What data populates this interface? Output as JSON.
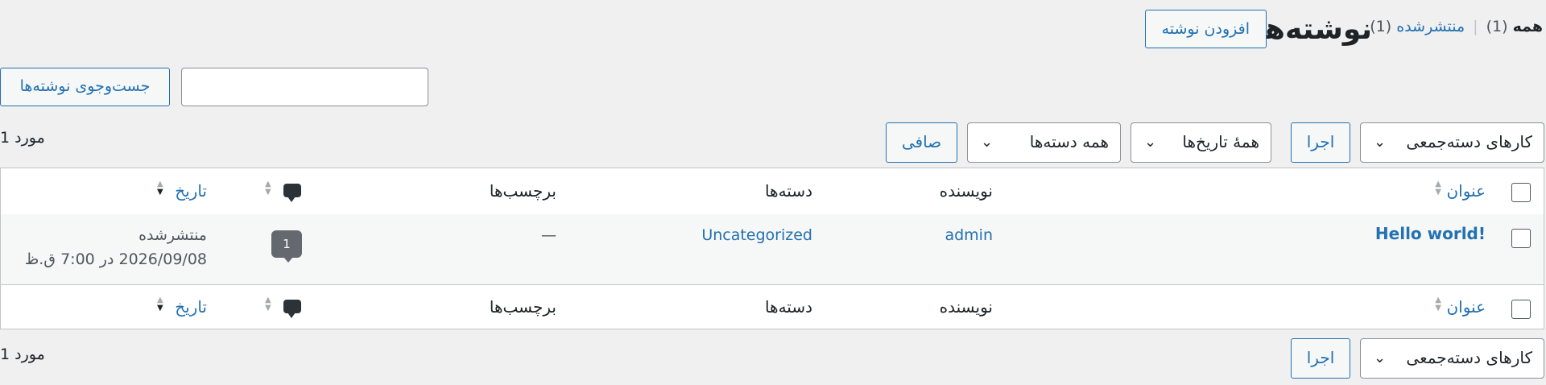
{
  "header": {
    "title": "نوشته‌ها",
    "add_new": "افزودن نوشته"
  },
  "views": {
    "all_label": "همه",
    "all_count": "(1)",
    "separator": "|",
    "published_label": "منتشرشده",
    "published_count": "(1)"
  },
  "search": {
    "input_value": "",
    "button_label": "جست‌وجوی نوشته‌ها"
  },
  "tablenav_top": {
    "bulk_actions": "کارهای دسته‌جمعی",
    "apply": "اجرا",
    "dates": "همهٔ تاریخ‌ها",
    "categories": "همه دسته‌ها",
    "filter": "صافی",
    "items_count": "1 مورد"
  },
  "columns": {
    "title": "عنوان",
    "author": "نویسنده",
    "categories": "دسته‌ها",
    "tags": "برچسب‌ها",
    "date": "تاریخ"
  },
  "rows": [
    {
      "title": "Hello world!",
      "author": "admin",
      "categories": "Uncategorized",
      "tags": "—",
      "comments": "1",
      "status": "منتشرشده",
      "datetime": "2026/09/08 در 7:00 ق.ظ"
    }
  ],
  "tablenav_bottom": {
    "bulk_actions": "کارهای دسته‌جمعی",
    "apply": "اجرا",
    "items_count": "1 مورد"
  },
  "colors": {
    "link": "#2271b1",
    "background": "#f0f0f1",
    "comment_bubble": "#646970"
  },
  "icons": {
    "chevron": "chevron-down-icon",
    "comments": "comment-icon",
    "sort": "sort-icon"
  }
}
